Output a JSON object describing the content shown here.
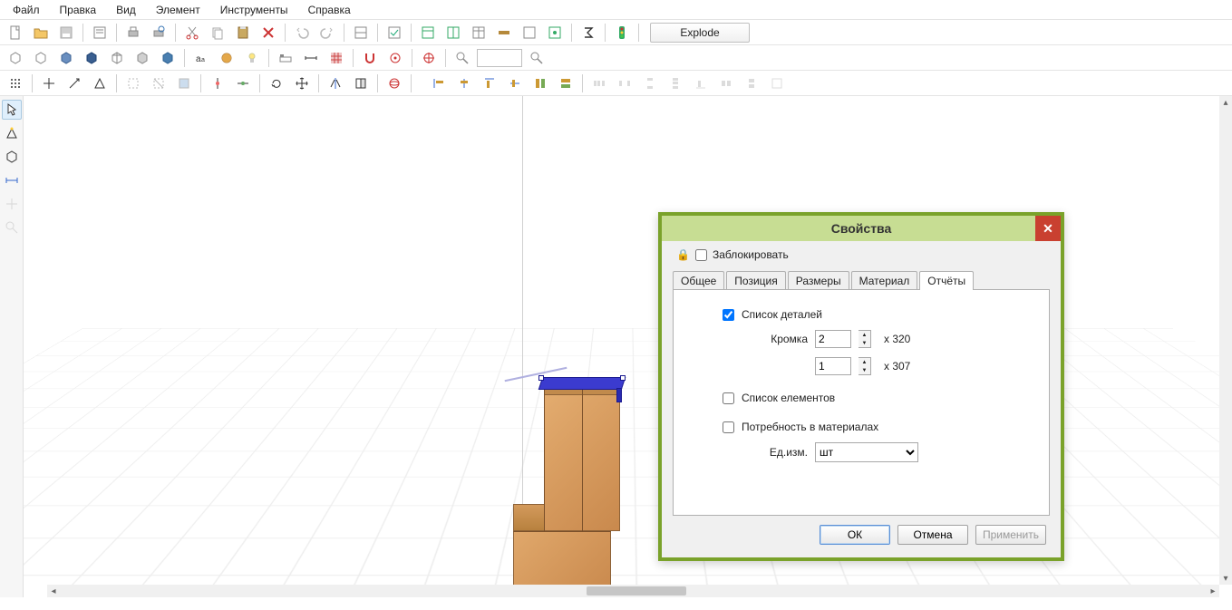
{
  "menu": {
    "file": "Файл",
    "edit": "Правка",
    "view": "Вид",
    "element": "Элемент",
    "tools": "Инструменты",
    "help": "Справка"
  },
  "toolbar": {
    "explode": "Explode"
  },
  "dialog": {
    "title": "Свойства",
    "lock": "Заблокировать",
    "tabs": {
      "general": "Общее",
      "position": "Позиция",
      "size": "Размеры",
      "material": "Материал",
      "reports": "Отчёты"
    },
    "reports": {
      "parts_list": "Список деталей",
      "edge_label": "Кромка",
      "edge1_value": "2",
      "edge1_suffix": "x 320",
      "edge2_value": "1",
      "edge2_suffix": "x 307",
      "elements_list": "Список елементов",
      "material_need": "Потребность в материалах",
      "unit_label": "Ед.изм.",
      "unit_value": "шт"
    },
    "buttons": {
      "ok": "ОК",
      "cancel": "Отмена",
      "apply": "Применить"
    }
  }
}
